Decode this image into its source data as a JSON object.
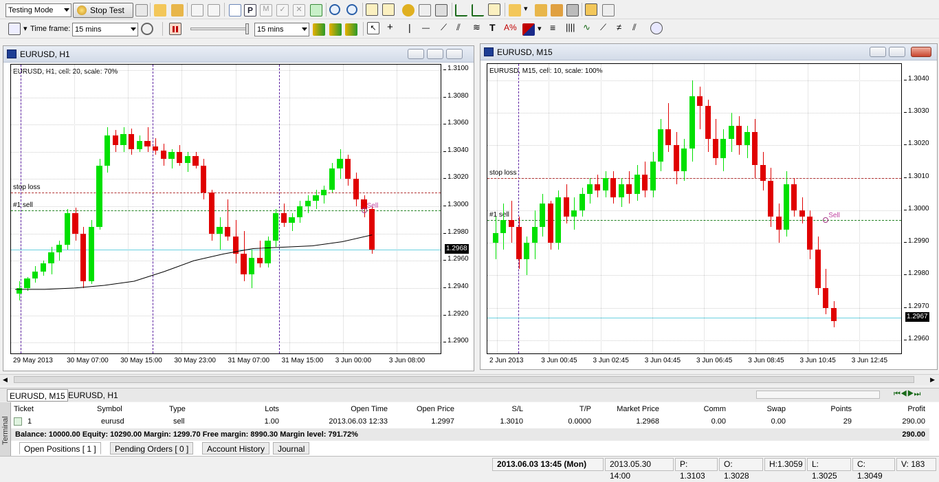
{
  "toolbar": {
    "mode_select": "Testing Mode",
    "stop_test_label": "Stop Test",
    "timeframe_label": "Time frame:",
    "timeframe_value": "15 mins",
    "speed_value": "15 mins"
  },
  "windows": [
    {
      "title": "EURUSD, H1",
      "info": "EURUSD, H1, cell: 20, scale: 70%",
      "stop_loss_label": "stop loss",
      "sell_label": "#1 sell",
      "trade_tag": "Sell",
      "current_price": "1.2968",
      "price_ticks": [
        "1.3100",
        "1.3080",
        "1.3060",
        "1.3040",
        "1.3020",
        "1.3000",
        "1.2980",
        "1.2960",
        "1.2940",
        "1.2920",
        "1.2900"
      ],
      "time_ticks": [
        "29 May 2013",
        "30 May 07:00",
        "30 May 15:00",
        "30 May 23:00",
        "31 May 07:00",
        "31 May 15:00",
        "3 Jun 00:00",
        "3 Jun 08:00"
      ]
    },
    {
      "title": "EURUSD, M15",
      "info": "EURUSD, M15, cell: 10, scale: 100%",
      "stop_loss_label": "stop loss",
      "sell_label": "#1 sell",
      "trade_tag": "Sell",
      "current_price": "1.2967",
      "price_ticks": [
        "1.3040",
        "1.3030",
        "1.3020",
        "1.3010",
        "1.3000",
        "1.2990",
        "1.2980",
        "1.2970",
        "1.2960"
      ],
      "time_ticks": [
        "2 Jun 2013",
        "3 Jun 00:45",
        "3 Jun 02:45",
        "3 Jun 04:45",
        "3 Jun 06:45",
        "3 Jun 08:45",
        "3 Jun 10:45",
        "3 Jun 12:45"
      ]
    }
  ],
  "chart_data": [
    {
      "type": "candlestick",
      "symbol": "EURUSD",
      "timeframe": "H1",
      "ylim": [
        1.2892,
        1.3104
      ],
      "levels": {
        "stop_loss": 1.301,
        "sell": 1.2997,
        "bid": 1.2968
      },
      "moving_average": [
        1.2939,
        1.2939,
        1.294,
        1.2942,
        1.2945,
        1.2952,
        1.296,
        1.2965,
        1.2969,
        1.297,
        1.2971,
        1.2974,
        1.2979
      ],
      "ohlc": [
        [
          1.2936,
          1.2945,
          1.2931,
          1.294
        ],
        [
          1.294,
          1.2948,
          1.2938,
          1.2947
        ],
        [
          1.2947,
          1.2956,
          1.2944,
          1.2952
        ],
        [
          1.2952,
          1.296,
          1.2949,
          1.2958
        ],
        [
          1.2958,
          1.297,
          1.295,
          1.2966
        ],
        [
          1.2966,
          1.2975,
          1.296,
          1.2972
        ],
        [
          1.2972,
          1.2998,
          1.2968,
          1.2995
        ],
        [
          1.2995,
          1.2999,
          1.2975,
          1.298
        ],
        [
          1.298,
          1.2985,
          1.294,
          1.2945
        ],
        [
          1.2945,
          1.299,
          1.2943,
          1.2985
        ],
        [
          1.2985,
          1.3035,
          1.2983,
          1.303
        ],
        [
          1.303,
          1.3058,
          1.3025,
          1.3052
        ],
        [
          1.3052,
          1.3056,
          1.304,
          1.3045
        ],
        [
          1.3045,
          1.3058,
          1.304,
          1.3053
        ],
        [
          1.3053,
          1.3057,
          1.3038,
          1.3042
        ],
        [
          1.3042,
          1.3052,
          1.304,
          1.3048
        ],
        [
          1.3048,
          1.3058,
          1.304,
          1.3044
        ],
        [
          1.3044,
          1.305,
          1.3038,
          1.3041
        ],
        [
          1.3041,
          1.3046,
          1.303,
          1.3035
        ],
        [
          1.3035,
          1.3042,
          1.3028,
          1.304
        ],
        [
          1.304,
          1.3045,
          1.303,
          1.3032
        ],
        [
          1.3032,
          1.304,
          1.3025,
          1.3037
        ],
        [
          1.3037,
          1.304,
          1.3028,
          1.303
        ],
        [
          1.303,
          1.3035,
          1.3005,
          1.301
        ],
        [
          1.301,
          1.3012,
          1.2975,
          1.298
        ],
        [
          1.298,
          1.2992,
          1.2968,
          1.2985
        ],
        [
          1.2985,
          1.3005,
          1.2975,
          1.2978
        ],
        [
          1.2978,
          1.299,
          1.2958,
          1.2965
        ],
        [
          1.2965,
          1.2982,
          1.2945,
          1.295
        ],
        [
          1.295,
          1.2968,
          1.294,
          1.2962
        ],
        [
          1.2962,
          1.2975,
          1.2955,
          1.2958
        ],
        [
          1.2958,
          1.2978,
          1.2955,
          1.2975
        ],
        [
          1.2975,
          1.2998,
          1.297,
          1.2995
        ],
        [
          1.2995,
          1.3002,
          1.2985,
          1.2988
        ],
        [
          1.2988,
          1.2995,
          1.2982,
          1.2992
        ],
        [
          1.2992,
          1.3004,
          1.2988,
          1.3
        ],
        [
          1.3,
          1.3008,
          1.2995,
          1.3004
        ],
        [
          1.3004,
          1.3012,
          1.2998,
          1.3008
        ],
        [
          1.3008,
          1.3015,
          1.3002,
          1.3012
        ],
        [
          1.3012,
          1.3032,
          1.301,
          1.3028
        ],
        [
          1.3028,
          1.3042,
          1.302,
          1.3035
        ],
        [
          1.3035,
          1.3038,
          1.3015,
          1.302
        ],
        [
          1.302,
          1.3025,
          1.3,
          1.3005
        ],
        [
          1.3005,
          1.3008,
          1.2992,
          1.2998
        ],
        [
          1.2998,
          1.3,
          1.2965,
          1.2968
        ]
      ]
    },
    {
      "type": "candlestick",
      "symbol": "EURUSD",
      "timeframe": "M15",
      "ylim": [
        1.2956,
        1.3045
      ],
      "levels": {
        "stop_loss": 1.301,
        "sell": 1.2997,
        "bid": 1.2967
      },
      "ohlc": [
        [
          1.299,
          1.2998,
          1.2985,
          1.2993
        ],
        [
          1.2993,
          1.3002,
          1.2988,
          1.2997
        ],
        [
          1.2997,
          1.3003,
          1.299,
          1.2995
        ],
        [
          1.2995,
          1.2998,
          1.2982,
          1.2985
        ],
        [
          1.2985,
          1.2992,
          1.298,
          1.299
        ],
        [
          1.299,
          1.3,
          1.2985,
          1.2995
        ],
        [
          1.2995,
          1.3005,
          1.2992,
          1.3002
        ],
        [
          1.3002,
          1.3003,
          1.2988,
          1.299
        ],
        [
          1.299,
          1.3006,
          1.2988,
          1.3004
        ],
        [
          1.3004,
          1.3008,
          1.2996,
          1.2998
        ],
        [
          1.2998,
          1.3004,
          1.2994,
          1.3
        ],
        [
          1.3,
          1.3007,
          1.2998,
          1.3005
        ],
        [
          1.3005,
          1.301,
          1.3002,
          1.3008
        ],
        [
          1.3008,
          1.3011,
          1.3004,
          1.3006
        ],
        [
          1.3006,
          1.3012,
          1.3004,
          1.301
        ],
        [
          1.301,
          1.3012,
          1.3002,
          1.3004
        ],
        [
          1.3004,
          1.301,
          1.3001,
          1.3008
        ],
        [
          1.3008,
          1.3012,
          1.3002,
          1.3005
        ],
        [
          1.3005,
          1.3014,
          1.3003,
          1.3011
        ],
        [
          1.3011,
          1.3015,
          1.3004,
          1.3006
        ],
        [
          1.3006,
          1.3018,
          1.3004,
          1.3015
        ],
        [
          1.3015,
          1.3028,
          1.3012,
          1.3025
        ],
        [
          1.3025,
          1.3033,
          1.3018,
          1.302
        ],
        [
          1.302,
          1.3024,
          1.3008,
          1.3012
        ],
        [
          1.3012,
          1.3022,
          1.3009,
          1.3019
        ],
        [
          1.3019,
          1.304,
          1.3015,
          1.3035
        ],
        [
          1.3035,
          1.3038,
          1.3025,
          1.3032
        ],
        [
          1.3032,
          1.3034,
          1.3018,
          1.3022
        ],
        [
          1.3022,
          1.3028,
          1.3014,
          1.3016
        ],
        [
          1.3016,
          1.3025,
          1.3012,
          1.3022
        ],
        [
          1.3022,
          1.303,
          1.3018,
          1.3026
        ],
        [
          1.3026,
          1.3029,
          1.3017,
          1.302
        ],
        [
          1.302,
          1.3026,
          1.3016,
          1.3024
        ],
        [
          1.3024,
          1.3028,
          1.301,
          1.3014
        ],
        [
          1.3014,
          1.3018,
          1.3006,
          1.3009
        ],
        [
          1.3009,
          1.3013,
          1.2995,
          1.2998
        ],
        [
          1.2998,
          1.3002,
          1.299,
          1.2994
        ],
        [
          1.2994,
          1.3012,
          1.2992,
          1.3008
        ],
        [
          1.3008,
          1.301,
          1.2998,
          1.3
        ],
        [
          1.3,
          1.3004,
          1.2996,
          1.2998
        ],
        [
          1.2998,
          1.3,
          1.2985,
          1.2988
        ],
        [
          1.2988,
          1.2992,
          1.2974,
          1.2976
        ],
        [
          1.2976,
          1.2982,
          1.2968,
          1.297
        ],
        [
          1.297,
          1.2972,
          1.2964,
          1.2966
        ]
      ]
    }
  ],
  "tabs": [
    "EURUSD, M15",
    "EURUSD, H1"
  ],
  "terminal": {
    "headers": [
      "Ticket",
      "Symbol",
      "Type",
      "Lots",
      "Open Time",
      "Open Price",
      "S/L",
      "T/P",
      "Market Price",
      "Comm",
      "Swap",
      "Points",
      "Profit"
    ],
    "row": [
      "1",
      "eurusd",
      "sell",
      "1.00",
      "2013.06.03 12:33",
      "1.2997",
      "1.3010",
      "0.0000",
      "1.2968",
      "0.00",
      "0.00",
      "29",
      "290.00"
    ],
    "balance_line": "Balance: 10000.00  Equity: 10290.00  Margin: 1299.70  Free margin: 8990.30  Margin level: 791.72%",
    "balance_profit": "290.00",
    "side_label": "Terminal",
    "tabs": [
      "Open Positions  [ 1 ]",
      "Pending Orders  [ 0 ]",
      "Account History",
      "Journal"
    ]
  },
  "status": [
    "2013.06.03 13:45 (Mon)",
    "2013.05.30 14:00",
    "P: 1.3103",
    "O: 1.3028",
    "H:1.3059",
    "L: 1.3025",
    "C: 1.3049",
    "V: 183"
  ],
  "colors": {
    "bull": "#00e000",
    "bear": "#e00000",
    "stop_loss": "#b03030",
    "sell": "#208020",
    "bid": "#6ad0e0",
    "separator": "#5a1ea0",
    "ma": "#000000"
  }
}
